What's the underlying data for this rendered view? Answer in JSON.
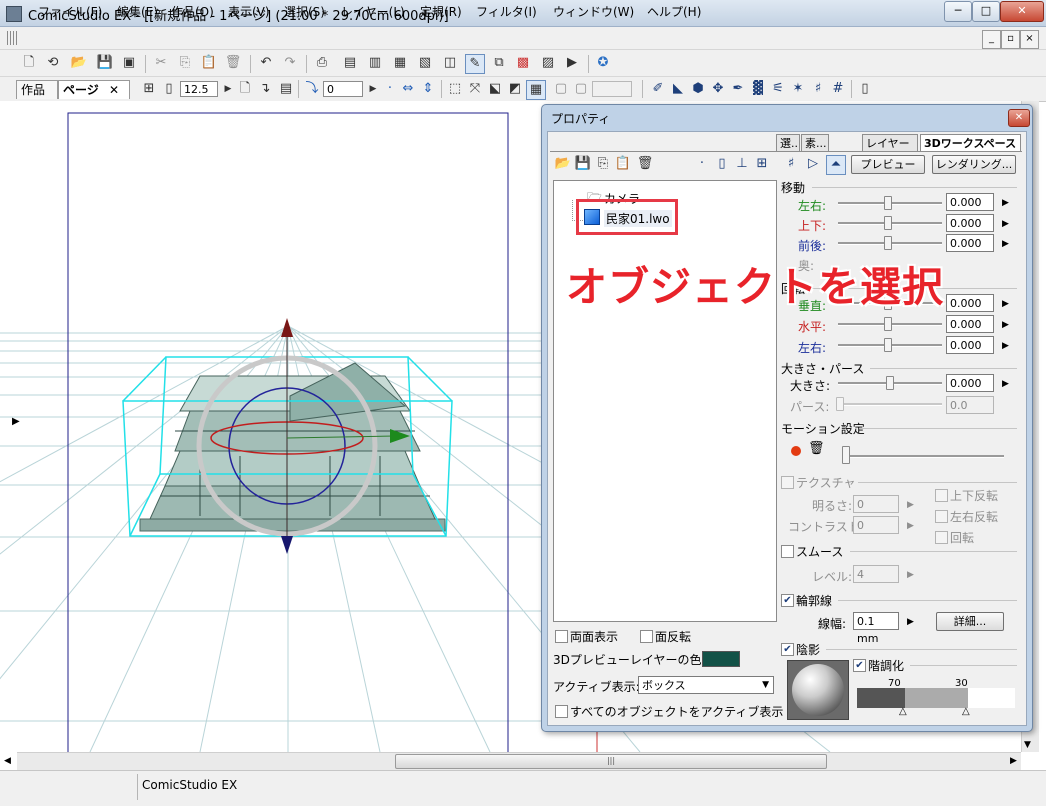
{
  "window": {
    "title": "ComicStudio EX - [[新規作品 - 1ページ] (21.00 * 29.70cm 600dpi)]",
    "minimize": "─",
    "maximize": "□",
    "close": "✕"
  },
  "menu": [
    "ファイル(F)",
    "編集(E)",
    "作品(O)",
    "表示(V)",
    "選択(S)",
    "レイヤー(L)",
    "定規(R)",
    "フィルタ(I)",
    "ウィンドウ(W)",
    "ヘルプ(H)"
  ],
  "toolbar": {
    "zoom_value": "12.5",
    "rotate_value": "0"
  },
  "doc_tabs": {
    "work": "作品",
    "page": "ページ",
    "page_close": "✕"
  },
  "status": {
    "text": "ComicStudio EX"
  },
  "properties": {
    "title": "プロパティ",
    "tabs": [
      "選...",
      "素...",
      "レイヤー",
      "3Dワークスペース"
    ],
    "preview_button": "プレビュー",
    "render_button": "レンダリング...",
    "tree": {
      "camera": "カメラ",
      "object": "民家01.lwo"
    },
    "move": {
      "title": "移動",
      "left_right": "左右:",
      "up_down": "上下:",
      "front_back": "前後:",
      "depth": "奥:",
      "v1": "0.000",
      "v2": "0.000",
      "v3": "0.000"
    },
    "rotate": {
      "title": "回転",
      "vertical": "垂直:",
      "horizontal": "水平:",
      "left_right": "左右:",
      "v1": "0.000",
      "v2": "0.000",
      "v3": "0.000"
    },
    "size": {
      "title": "大きさ・パース",
      "size": "大きさ:",
      "perspective": "パース:",
      "v1": "0.000",
      "v2": "0.0"
    },
    "motion": {
      "title": "モーション設定"
    },
    "texture": {
      "title": "テクスチャ",
      "brightness": "明るさ:",
      "contrast": "コントラスト:",
      "v1": "0",
      "v2": "0",
      "flip_v": "上下反転",
      "flip_h": "左右反転",
      "rotate": "回転"
    },
    "smooth": {
      "title": "スムース",
      "level": "レベル:",
      "v1": "4"
    },
    "outline": {
      "title": "輪郭線",
      "width": "線幅:",
      "width_value": "0.1 mm",
      "detail_button": "詳細..."
    },
    "shading": {
      "title": "陰影",
      "gradation": "階調化",
      "v1": "70",
      "v2": "30"
    },
    "both_sides": "両面表示",
    "flip_face": "面反転",
    "preview_color_label": "3Dプレビューレイヤーの色:",
    "preview_color": "#135247",
    "active_label": "アクティブ表示:",
    "active_value": "ボックス",
    "all_active": "すべてのオブジェクトをアクティブ表示"
  },
  "annotation": {
    "text": "オブジェクトを選択"
  }
}
